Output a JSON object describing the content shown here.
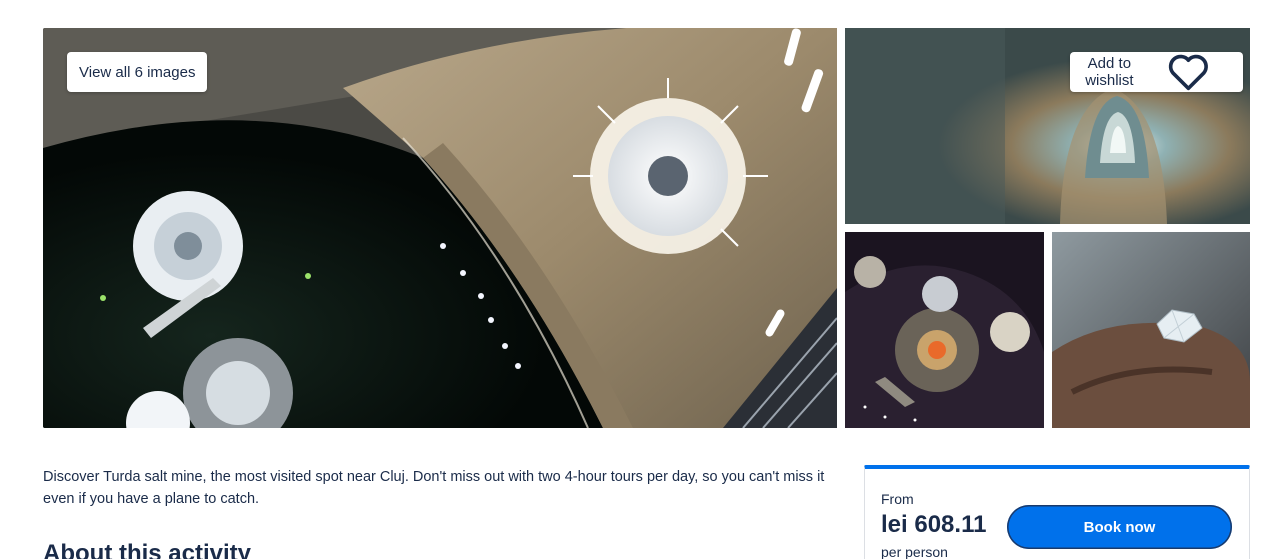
{
  "rating": {
    "stars": "★★★★★"
  },
  "gallery": {
    "view_all_label": "View all 6 images",
    "wishlist_label": "Add to wishlist"
  },
  "description": "Discover Turda salt mine, the most visited spot near Cluj. Don't miss out with two 4-hour tours per day, so you can't miss it even if you have a plane to catch.",
  "about": {
    "heading": "About this activity"
  },
  "booking": {
    "from_label": "From",
    "price": "lei 608.11",
    "per_person": "per person",
    "book_label": "Book now"
  },
  "colors": {
    "accent": "#0071eb",
    "text": "#1a2b49",
    "star": "#f5b400"
  },
  "icons": {
    "heart": "heart-icon"
  }
}
